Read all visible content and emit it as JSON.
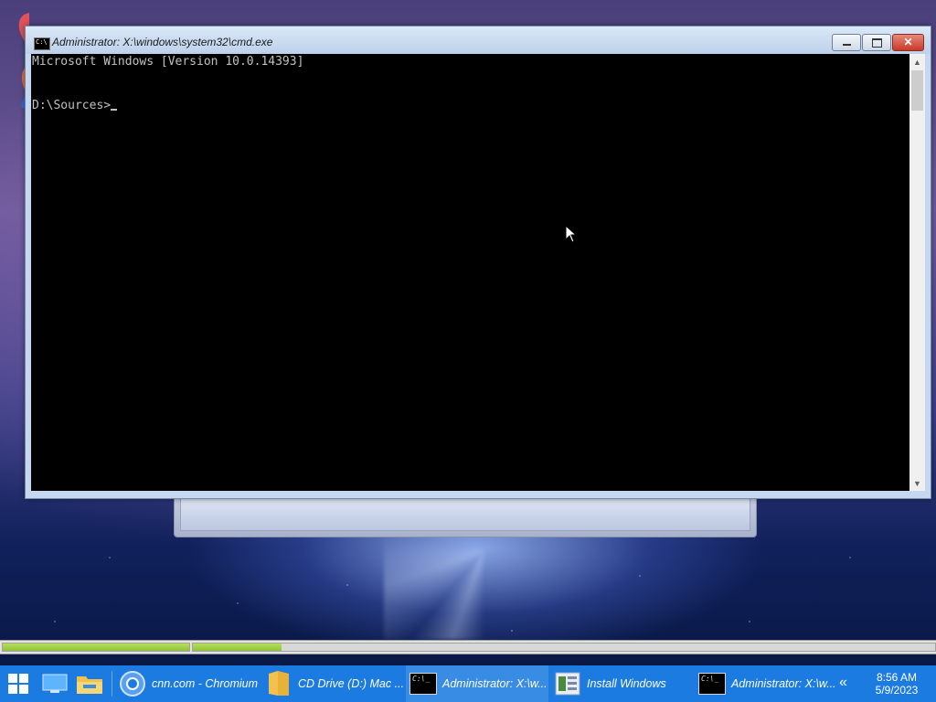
{
  "cmd_window": {
    "title": "Administrator: X:\\windows\\system32\\cmd.exe",
    "console_lines": [
      "Microsoft Windows [Version 10.0.14393]"
    ],
    "prompt": "D:\\Sources>"
  },
  "progress": {
    "segment1_fill": 1.0,
    "segment2_fill": 0.12
  },
  "taskbar": {
    "items": [
      {
        "label": "cnn.com - Chromium",
        "icon": "chromium-icon"
      },
      {
        "label": "CD Drive (D:) Mac ...",
        "icon": "folder-icon"
      },
      {
        "label": "Administrator: X:\\w...",
        "icon": "cmd-icon"
      },
      {
        "label": "Install Windows",
        "icon": "installer-icon"
      },
      {
        "label": "Administrator: X:\\w...",
        "icon": "cmd-icon"
      }
    ],
    "clock_time": "8:56 AM",
    "clock_date": "5/9/2023"
  },
  "colors": {
    "taskbar": "#1c7be0",
    "console_bg": "#000000",
    "console_fg": "#c0c0c0",
    "progress_green": "#8fc43a",
    "close_button": "#c9392a"
  }
}
